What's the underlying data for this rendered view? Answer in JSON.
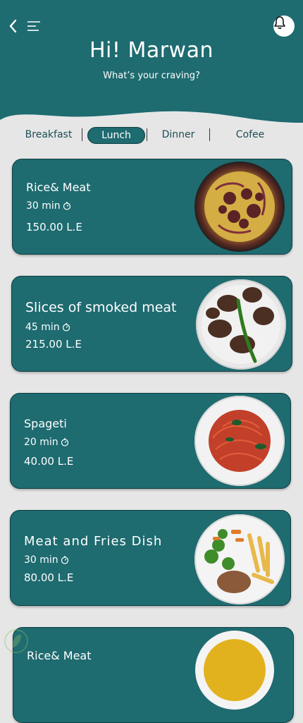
{
  "header": {
    "greeting": "Hi! Marwan",
    "subtitle": "What’s your craving?",
    "icons": [
      "chevron-left-icon",
      "menu-lines-icon",
      "bell-icon"
    ],
    "color": "#1e6b70"
  },
  "tabs": [
    {
      "label": "Breakfast",
      "active": false
    },
    {
      "label": "Lunch",
      "active": true
    },
    {
      "label": "Dinner",
      "active": false
    },
    {
      "label": "Cofee",
      "active": false
    }
  ],
  "dishes": [
    {
      "name": "Rice& Meat",
      "time": "30 min",
      "price": "150.00 L.E"
    },
    {
      "name": "Slices of smoked meat",
      "time": "45 min",
      "price": "215.00 L.E"
    },
    {
      "name": "Spageti",
      "time": "20 min",
      "price": "40.00 L.E"
    },
    {
      "name": "Meat and Fries Dish",
      "time": "30 min",
      "price": "80.00 L.E"
    },
    {
      "name": "Rice& Meat"
    }
  ]
}
